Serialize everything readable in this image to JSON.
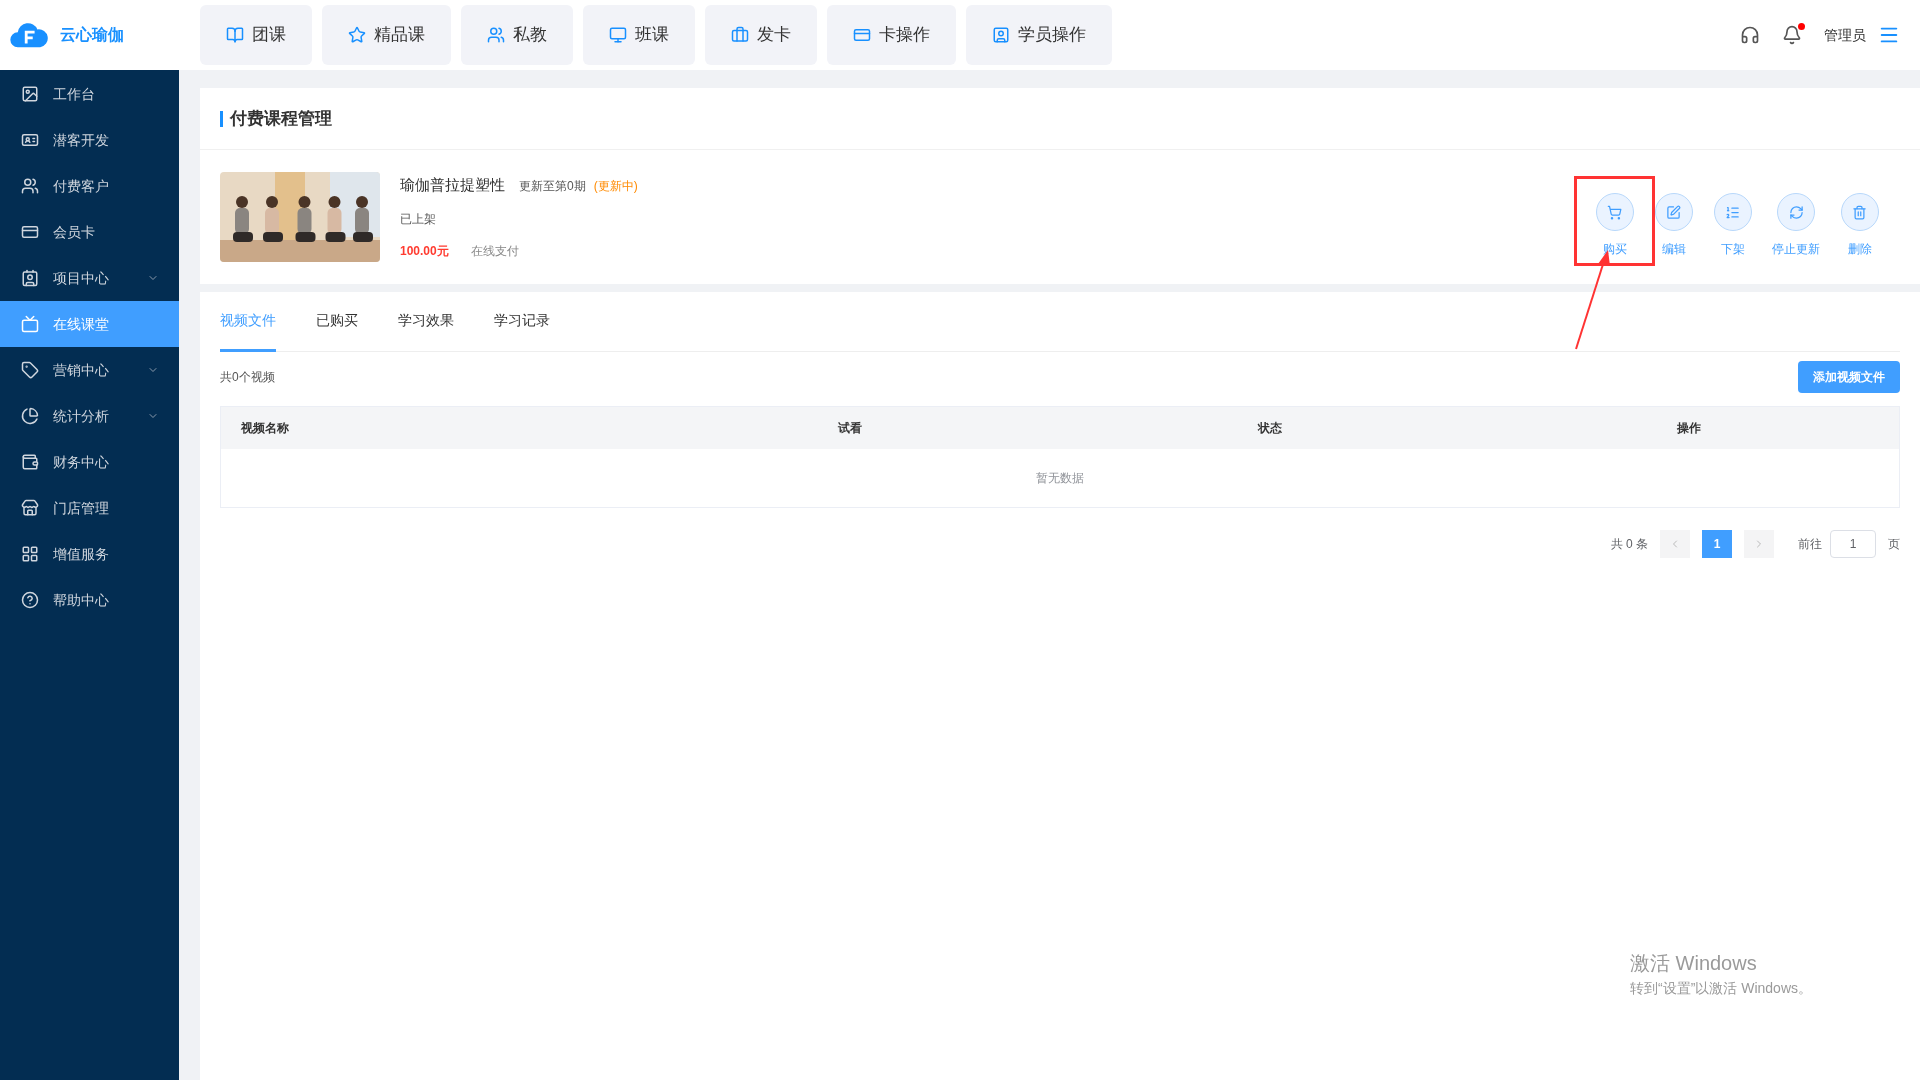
{
  "logo_text": "云心瑜伽",
  "top_nav": [
    {
      "label": "团课"
    },
    {
      "label": "精品课"
    },
    {
      "label": "私教"
    },
    {
      "label": "班课"
    },
    {
      "label": "发卡"
    },
    {
      "label": "卡操作"
    },
    {
      "label": "学员操作"
    }
  ],
  "header": {
    "notification_unread": true,
    "user": "管理员"
  },
  "sidebar": {
    "items": [
      {
        "label": "工作台",
        "selected": false,
        "expandable": false
      },
      {
        "label": "潜客开发",
        "selected": false,
        "expandable": false
      },
      {
        "label": "付费客户",
        "selected": false,
        "expandable": false
      },
      {
        "label": "会员卡",
        "selected": false,
        "expandable": false
      },
      {
        "label": "项目中心",
        "selected": false,
        "expandable": true
      },
      {
        "label": "在线课堂",
        "selected": true,
        "expandable": false
      },
      {
        "label": "营销中心",
        "selected": false,
        "expandable": true
      },
      {
        "label": "统计分析",
        "selected": false,
        "expandable": true
      },
      {
        "label": "财务中心",
        "selected": false,
        "expandable": false
      },
      {
        "label": "门店管理",
        "selected": false,
        "expandable": false
      },
      {
        "label": "增值服务",
        "selected": false,
        "expandable": false
      },
      {
        "label": "帮助中心",
        "selected": false,
        "expandable": false
      }
    ]
  },
  "page_title": "付费课程管理",
  "course": {
    "title": "瑜伽普拉提塑性",
    "update_info": "更新至第0期",
    "update_status": "(更新中)",
    "shelf_status": "已上架",
    "price": "100.00元",
    "payment": "在线支付"
  },
  "actions": [
    {
      "label": "购买",
      "highlighted": true
    },
    {
      "label": "编辑",
      "highlighted": false
    },
    {
      "label": "下架",
      "highlighted": false
    },
    {
      "label": "停止更新",
      "highlighted": false
    },
    {
      "label": "删除",
      "highlighted": false
    }
  ],
  "tabs": [
    {
      "label": "视频文件",
      "selected": true
    },
    {
      "label": "已购买",
      "selected": false
    },
    {
      "label": "学习效果",
      "selected": false
    },
    {
      "label": "学习记录",
      "selected": false
    }
  ],
  "video_count": "共0个视频",
  "add_button": "添加视频文件",
  "table": {
    "columns": [
      "视频名称",
      "试看",
      "状态",
      "操作"
    ],
    "empty_text": "暂无数据"
  },
  "pagination": {
    "total": "共 0 条",
    "pages": [
      {
        "label": "1",
        "selected": true
      }
    ],
    "goto_label": "前往",
    "goto_value": "1",
    "page_suffix": "页"
  },
  "os_notice": {
    "title": "激活 Windows",
    "subtitle": "转到“设置”以激活 Windows。"
  }
}
